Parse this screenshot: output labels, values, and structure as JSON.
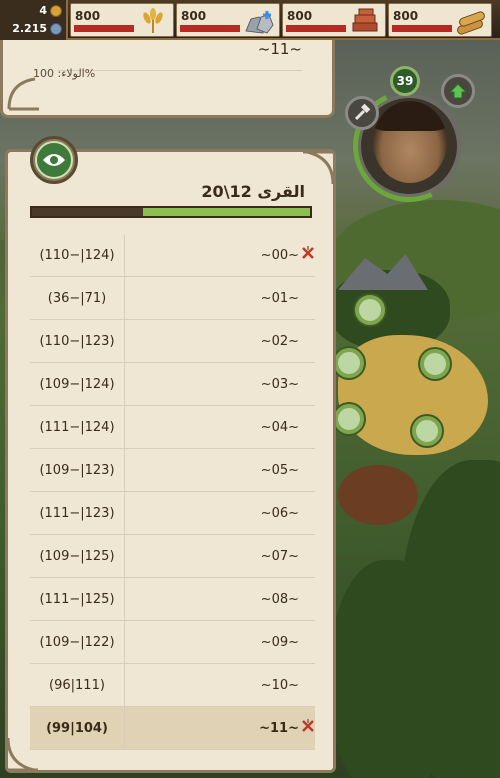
{
  "currency": {
    "gold": "4",
    "gems": "2.215"
  },
  "resources": [
    {
      "name": "food",
      "value": "800",
      "icon": "wheat-icon",
      "fill": 0.6
    },
    {
      "name": "stone",
      "value": "800",
      "icon": "stone-icon",
      "fill": 0.6
    },
    {
      "name": "bricks",
      "value": "800",
      "icon": "bricks-icon",
      "fill": 0.6
    },
    {
      "name": "wood",
      "value": "800",
      "icon": "logs-icon",
      "fill": 0.6
    }
  ],
  "notice": {
    "village_name": "~11~",
    "loyalty": "الولاء: 100%"
  },
  "hero": {
    "level": "39"
  },
  "panel": {
    "title": "القرى 12\\20",
    "progress": 0.6,
    "villages": [
      {
        "name": "~00~",
        "coords": "(110−|124)",
        "marked": true,
        "selected": false
      },
      {
        "name": "~01~",
        "coords": "(36−|71)",
        "marked": false,
        "selected": false
      },
      {
        "name": "~02~",
        "coords": "(110−|123)",
        "marked": false,
        "selected": false
      },
      {
        "name": "~03~",
        "coords": "(109−|124)",
        "marked": false,
        "selected": false
      },
      {
        "name": "~04~",
        "coords": "(111−|124)",
        "marked": false,
        "selected": false
      },
      {
        "name": "~05~",
        "coords": "(109−|123)",
        "marked": false,
        "selected": false
      },
      {
        "name": "~06~",
        "coords": "(111−|123)",
        "marked": false,
        "selected": false
      },
      {
        "name": "~07~",
        "coords": "(109−|125)",
        "marked": false,
        "selected": false
      },
      {
        "name": "~08~",
        "coords": "(111−|125)",
        "marked": false,
        "selected": false
      },
      {
        "name": "~09~",
        "coords": "(109−|122)",
        "marked": false,
        "selected": false
      },
      {
        "name": "~10~",
        "coords": "(96|111)",
        "marked": false,
        "selected": false
      },
      {
        "name": "~11~",
        "coords": "(99|104)",
        "marked": true,
        "selected": true
      }
    ]
  },
  "colors": {
    "accent_green": "#8bbf4f",
    "resource_bar": "#b52a22",
    "panel_bg": "#efe7d3"
  }
}
